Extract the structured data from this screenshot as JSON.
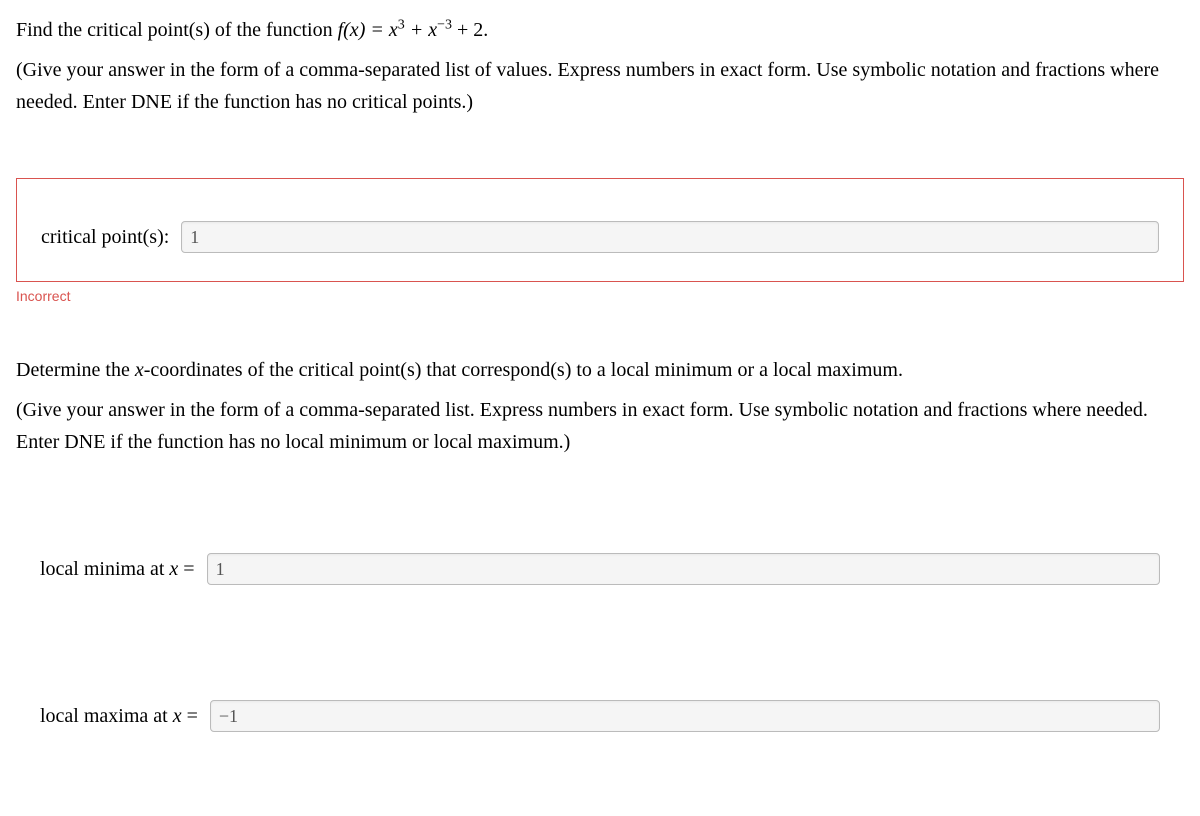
{
  "question1": {
    "prompt_prefix": "Find the critical point(s) of the function ",
    "function_label": "f(x) = x",
    "exp1": "3",
    "plus": " + x",
    "exp2": "−3",
    "tail": " + 2.",
    "instruction": "(Give your answer in the form of a comma-separated list of values. Express numbers in exact form. Use symbolic notation and fractions where needed. Enter DNE if the function has no critical points.)",
    "label": "critical point(s):",
    "value": "1",
    "feedback": "Incorrect"
  },
  "question2": {
    "prompt": "Determine the x-coordinates of the critical point(s) that correspond(s) to a local minimum or a local maximum.",
    "instruction": "(Give your answer in the form of a comma-separated list. Express numbers in exact form. Use symbolic notation and fractions where needed. Enter DNE if the function has no local minimum or local maximum.)",
    "minima_label_prefix": "local minima at ",
    "minima_label_var": "x",
    "minima_label_suffix": " =",
    "minima_value": "1",
    "maxima_label_prefix": "local maxima at ",
    "maxima_label_var": "x",
    "maxima_label_suffix": " =",
    "maxima_value": "−1"
  }
}
